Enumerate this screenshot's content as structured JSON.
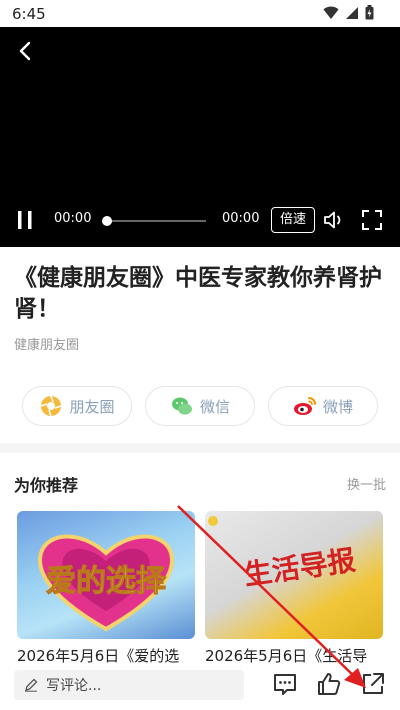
{
  "status_bar": {
    "time": "6:45"
  },
  "player": {
    "current_time": "00:00",
    "total_time": "00:00",
    "speed_label": "倍速",
    "progress": 0
  },
  "article": {
    "title": "《健康朋友圈》中医专家教你养肾护肾！",
    "source": "健康朋友圈"
  },
  "share": {
    "items": [
      {
        "label": "朋友圈",
        "icon": "moments-icon"
      },
      {
        "label": "微信",
        "icon": "wechat-icon"
      },
      {
        "label": "微博",
        "icon": "weibo-icon"
      }
    ]
  },
  "recommend": {
    "title": "为你推荐",
    "refresh_label": "换一批",
    "cards": [
      {
        "caption": "2026年5月6日《爱的选",
        "thumb_text": "爱的选择"
      },
      {
        "caption": "2026年5月6日《生活导",
        "thumb_text": "生活导报"
      }
    ]
  },
  "bottom_bar": {
    "comment_placeholder": "写评论..."
  },
  "colors": {
    "annotation_arrow": "#e02020",
    "share_text": "#8aa0b8"
  }
}
